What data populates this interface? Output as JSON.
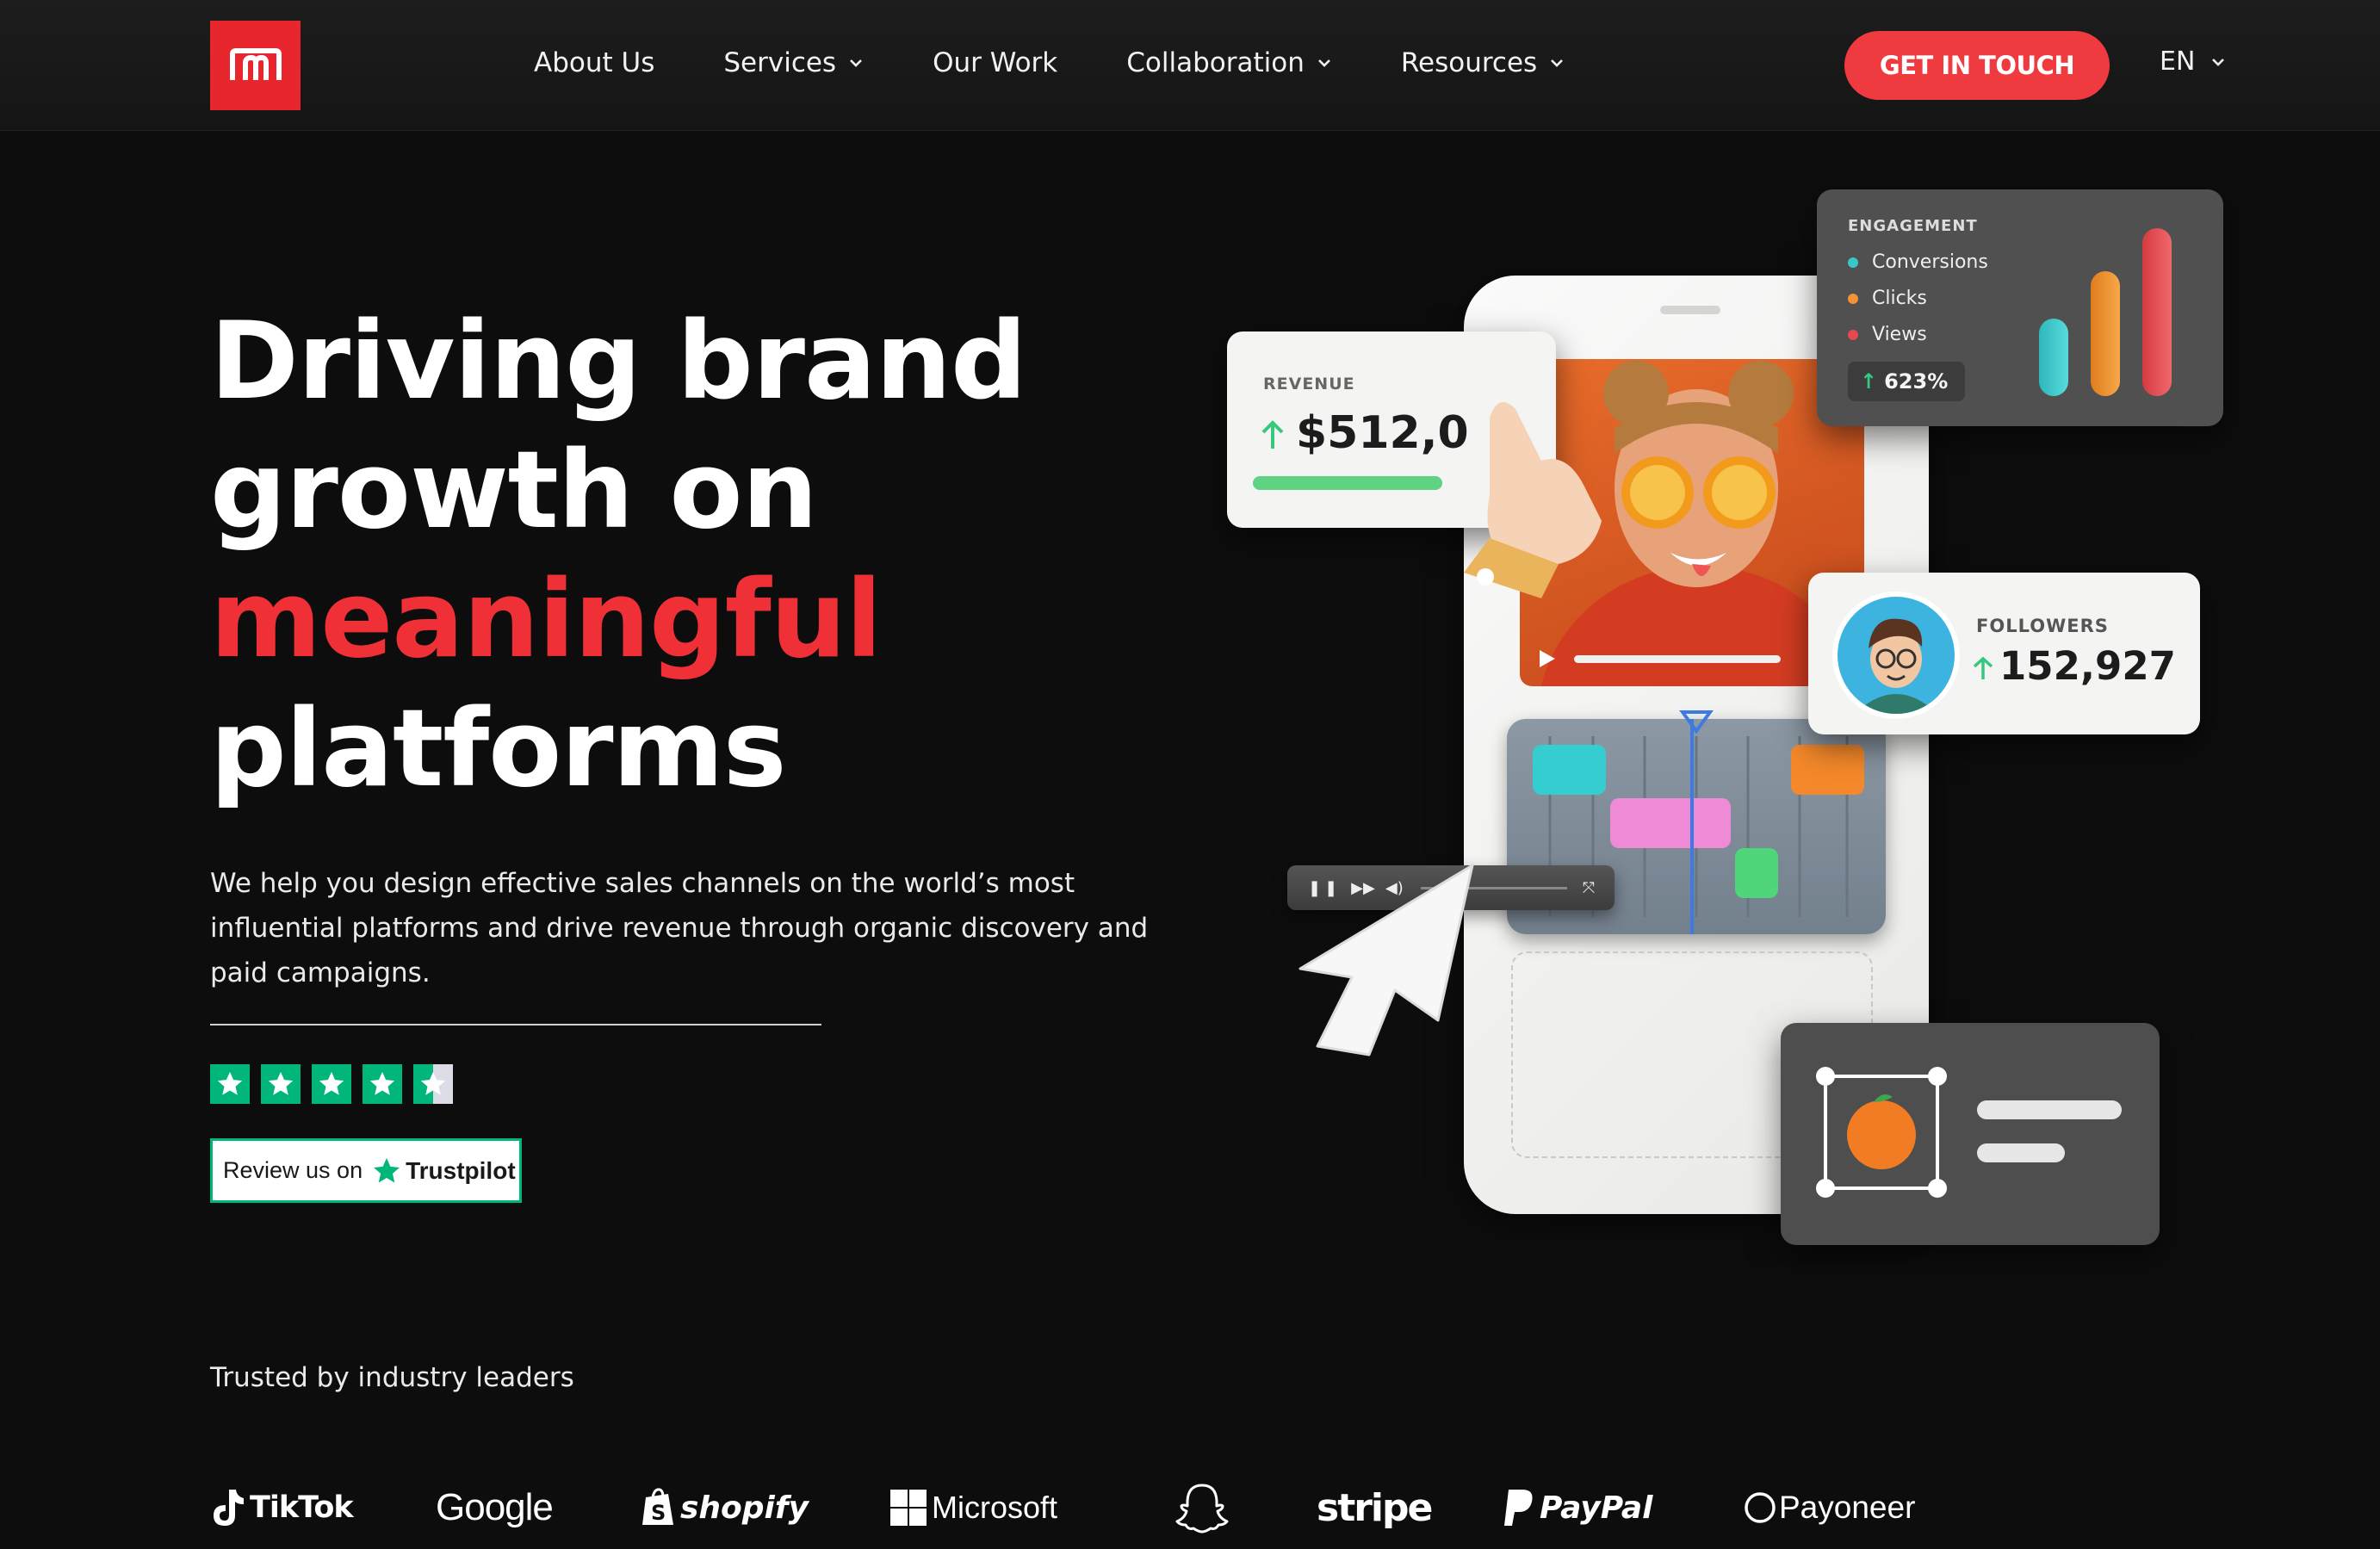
{
  "brand": {
    "logo_alt": "m",
    "accent": "#ef3036",
    "cta_color": "#ef3b40"
  },
  "nav": {
    "items": [
      {
        "label": "About Us",
        "dropdown": false
      },
      {
        "label": "Services",
        "dropdown": true
      },
      {
        "label": "Our Work",
        "dropdown": false
      },
      {
        "label": "Collaboration",
        "dropdown": true
      },
      {
        "label": "Resources",
        "dropdown": true
      }
    ],
    "cta": "GET IN TOUCH",
    "language": "EN"
  },
  "hero": {
    "title_line1": "Driving brand",
    "title_line2": "growth on",
    "title_highlight": "meaningful",
    "title_line4": "platforms",
    "description": "We help you design effective sales channels on the world’s most influential platforms and drive revenue through organic discovery and paid campaigns."
  },
  "rating": {
    "stars": 4.5,
    "max_stars": 5,
    "review_prefix": "Review us on",
    "review_brand": "Trustpilot",
    "color": "#00b67a"
  },
  "illustration": {
    "revenue": {
      "label": "REVENUE",
      "value": "$512,0"
    },
    "engagement": {
      "label": "ENGAGEMENT",
      "legend": [
        {
          "name": "Conversions",
          "color": "#37c7c7"
        },
        {
          "name": "Clicks",
          "color": "#f19436"
        },
        {
          "name": "Views",
          "color": "#e5484d"
        }
      ],
      "change": "623%"
    },
    "followers": {
      "label": "FOLLOWERS",
      "value": "152,927"
    }
  },
  "trusted": {
    "heading": "Trusted by industry leaders",
    "logos": [
      "TikTok",
      "Google",
      "shopify",
      "Microsoft",
      "snapchat-icon",
      "stripe",
      "PayPal",
      "Payoneer"
    ]
  }
}
